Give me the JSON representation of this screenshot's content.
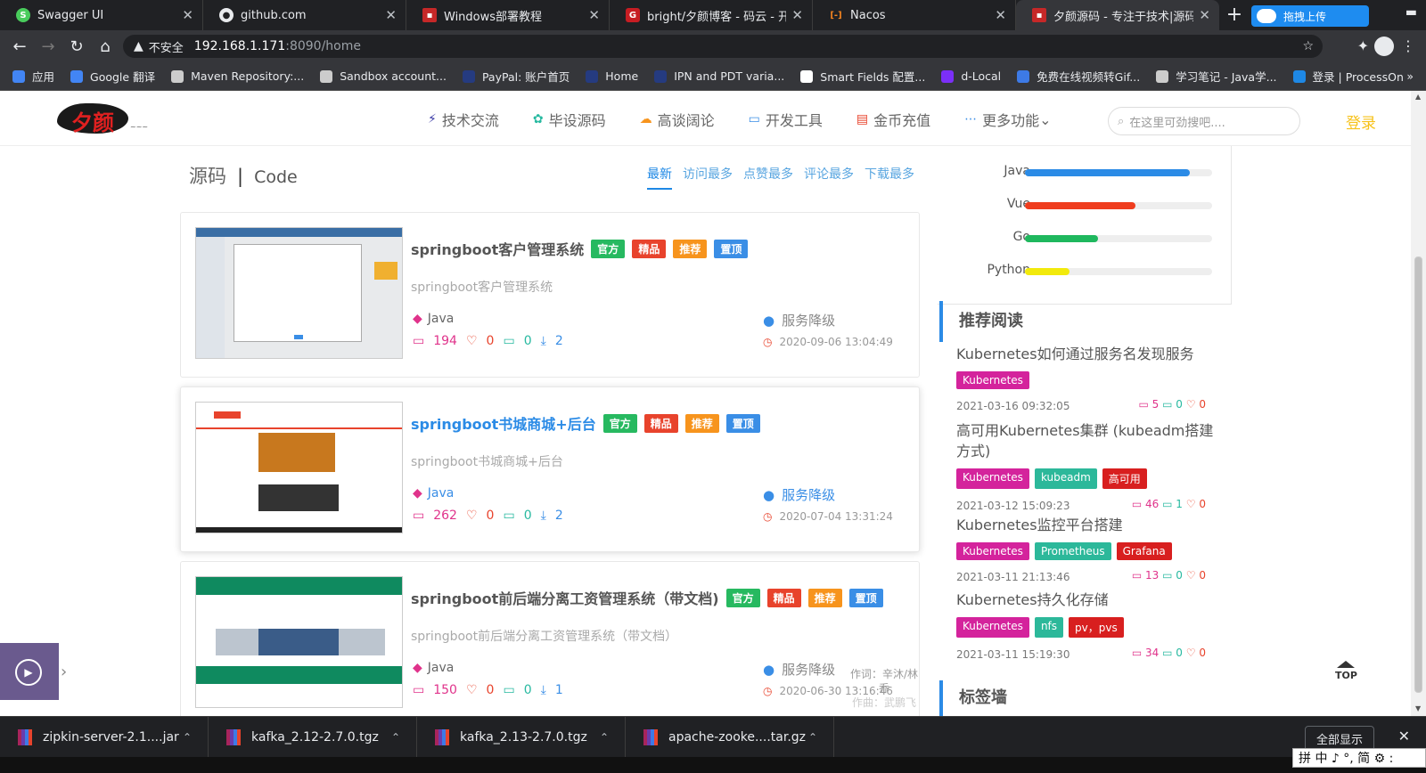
{
  "browser": {
    "tabs": [
      {
        "title": "Swagger UI",
        "icon_color": "#49cc5c",
        "icon": "swagger-icon"
      },
      {
        "title": "github.com",
        "icon_color": "#e8eaed",
        "icon": "github-icon"
      },
      {
        "title": "Windows部署教程",
        "icon_color": "#c62828",
        "icon": "blog-icon"
      },
      {
        "title": "bright/夕颜博客 - 码云 - 开源",
        "icon_color": "#c71d23",
        "icon": "gitee-icon"
      },
      {
        "title": "Nacos",
        "icon_color": "#f5841f",
        "icon": "nacos-icon"
      },
      {
        "title": "夕颜源码 - 专注于技术|源码分享",
        "icon_color": "#c62828",
        "icon": "site-icon"
      }
    ],
    "ext_label": "拖拽上传",
    "address": {
      "security": "不安全",
      "host": "192.168.1.171",
      "path": ":8090/home"
    },
    "bookmarks": [
      {
        "label": "应用",
        "color": "#4285f4"
      },
      {
        "label": "Google 翻译",
        "color": "#4285f4"
      },
      {
        "label": "Maven Repository:...",
        "color": "#cccccc"
      },
      {
        "label": "Sandbox account...",
        "color": "#cccccc"
      },
      {
        "label": "PayPal: 账户首页",
        "color": "#253b80"
      },
      {
        "label": "Home",
        "color": "#253b80"
      },
      {
        "label": "IPN and PDT varia...",
        "color": "#253b80"
      },
      {
        "label": "Smart Fields 配置...",
        "color": "#ffffff"
      },
      {
        "label": "d-Local",
        "color": "#7b2ff7"
      },
      {
        "label": "免费在线视频转Gif...",
        "color": "#3d7ae6"
      },
      {
        "label": "学习笔记 - Java学...",
        "color": "#cccccc"
      },
      {
        "label": "登录 | ProcessOn",
        "color": "#1e88e5"
      }
    ]
  },
  "site": {
    "logo_text": "夕颜",
    "nav": [
      {
        "label": "技术交流",
        "icon": "tech-icon",
        "icon_glyph": "⚡",
        "color": "#3a3aa6"
      },
      {
        "label": "毕设源码",
        "icon": "code-icon",
        "icon_glyph": "✿",
        "color": "#27b9a0"
      },
      {
        "label": "高谈阔论",
        "icon": "cloud-icon",
        "icon_glyph": "☁",
        "color": "#f7941d"
      },
      {
        "label": "开发工具",
        "icon": "tool-icon",
        "icon_glyph": "▭",
        "color": "#3a8ee6"
      },
      {
        "label": "金币充值",
        "icon": "coin-icon",
        "icon_glyph": "▤",
        "color": "#e8432c"
      },
      {
        "label": "更多功能",
        "icon": "more-icon",
        "icon_glyph": "⋯",
        "color": "#3a8ee6"
      }
    ],
    "search_placeholder": "在这里可劲搜吧....",
    "login": "登录"
  },
  "section": {
    "title_cn": "源码",
    "sep": "|",
    "title_en": "Code",
    "filters": [
      "最新",
      "访问最多",
      "点赞最多",
      "评论最多",
      "下载最多"
    ]
  },
  "cards": [
    {
      "title": "springboot客户管理系统",
      "subtitle": "springboot客户管理系统",
      "tags": [
        "官方",
        "精品",
        "推荐",
        "置顶"
      ],
      "lang": "Java",
      "views": "194",
      "likes": "0",
      "comments": "0",
      "downloads": "2",
      "author": "服务降级",
      "date": "2020-09-06 13:04:49"
    },
    {
      "title": "springboot书城商城+后台",
      "subtitle": "springboot书城商城+后台",
      "tags": [
        "官方",
        "精品",
        "推荐",
        "置顶"
      ],
      "lang": "Java",
      "views": "262",
      "likes": "0",
      "comments": "0",
      "downloads": "2",
      "author": "服务降级",
      "date": "2020-07-04 13:31:24"
    },
    {
      "title": "springboot前后端分离工资管理系统（带文档)",
      "subtitle": "springboot前后端分离工资管理系统（带文档）",
      "tags": [
        "官方",
        "精品",
        "推荐",
        "置顶"
      ],
      "lang": "Java",
      "views": "150",
      "likes": "0",
      "comments": "0",
      "downloads": "1",
      "author": "服务降级",
      "date": "2020-06-30 13:16:46",
      "lyric1": "作词：辛沐/林乔",
      "lyric2": "作曲：武鹏飞"
    }
  ],
  "lang_bars": [
    {
      "name": "Java",
      "value": 0.88,
      "color": "#2b8be6"
    },
    {
      "name": "Vue",
      "value": 0.59,
      "color": "#ef3d1e"
    },
    {
      "name": "Go",
      "value": 0.39,
      "color": "#1fb85e"
    },
    {
      "name": "Python",
      "value": 0.24,
      "color": "#f2ea0c"
    }
  ],
  "recommend": {
    "title": "推荐阅读",
    "items": [
      {
        "title": "Kubernetes如何通过服务名发现服务",
        "tags": [
          "Kubernetes"
        ],
        "date": "2021-03-16 09:32:05",
        "views": "5",
        "comments": "0",
        "likes": "0"
      },
      {
        "title": "高可用Kubernetes集群 (kubeadm搭建方式)",
        "tags": [
          "Kubernetes",
          "kubeadm",
          "高可用"
        ],
        "date": "2021-03-12 15:09:23",
        "views": "46",
        "comments": "1",
        "likes": "0"
      },
      {
        "title": "Kubernetes监控平台搭建",
        "tags": [
          "Kubernetes",
          "Prometheus",
          "Grafana"
        ],
        "date": "2021-03-11 21:13:46",
        "views": "13",
        "comments": "0",
        "likes": "0"
      },
      {
        "title": "Kubernetes持久化存储",
        "tags": [
          "Kubernetes",
          "nfs",
          "pv，pvs"
        ],
        "date": "2021-03-11 15:19:30",
        "views": "34",
        "comments": "0",
        "likes": "0"
      }
    ]
  },
  "tag_wall_title": "标签墙",
  "top_label": "TOP",
  "downloads": [
    {
      "name": "zipkin-server-2.1....jar"
    },
    {
      "name": "kafka_2.12-2.7.0.tgz"
    },
    {
      "name": "kafka_2.13-2.7.0.tgz"
    },
    {
      "name": "apache-zooke....tar.gz"
    }
  ],
  "show_all": "全部显示",
  "ime": "拼 中 ♪ °, 简 ⚙ :"
}
